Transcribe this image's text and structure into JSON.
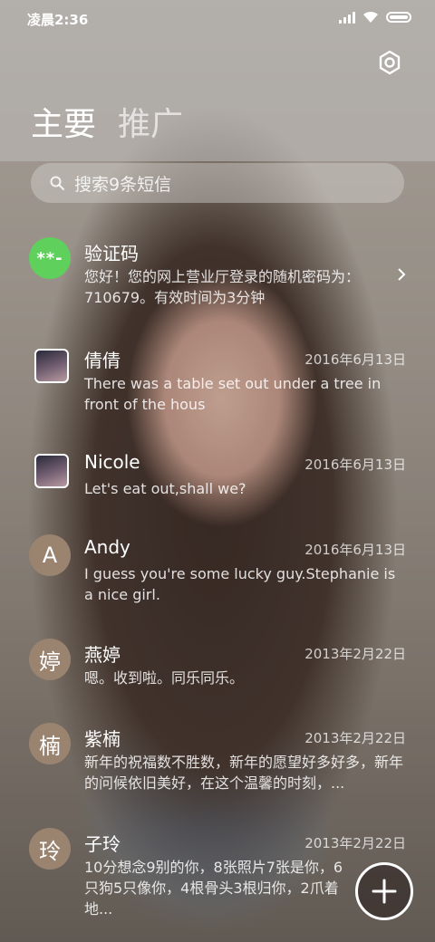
{
  "status_bar": {
    "time": "凌晨2:36"
  },
  "tabs": [
    {
      "label": "主要"
    },
    {
      "label": "推广"
    }
  ],
  "search": {
    "placeholder": "搜索9条短信"
  },
  "conversations": [
    {
      "avatar": "**-",
      "name": "验证码",
      "date": "",
      "preview": "您好！您的网上营业厅登录的随机密码为：710679。有效时间为3分钟"
    },
    {
      "avatar": "",
      "name": "倩倩",
      "date": "2016年6月13日",
      "preview": "There was a table set out under a tree in front of the hous"
    },
    {
      "avatar": "",
      "name": "Nicole",
      "date": "2016年6月13日",
      "preview": "Let's eat out,shall we?"
    },
    {
      "avatar": "A",
      "name": "Andy",
      "date": "2016年6月13日",
      "preview": "I guess you're some lucky guy.Stephanie is a nice girl."
    },
    {
      "avatar": "婷",
      "name": "燕婷",
      "date": "2013年2月22日",
      "preview": "嗯。收到啦。同乐同乐。"
    },
    {
      "avatar": "楠",
      "name": "紫楠",
      "date": "2013年2月22日",
      "preview": "新年的祝福数不胜数，新年的愿望好多好多，新年的问候依旧美好，在这个温馨的时刻，..."
    },
    {
      "avatar": "玲",
      "name": "子玲",
      "date": "2013年2月22日",
      "preview": "10分想念9别的你，8张照片7张是你，6只狗5只像你，4根骨头3根归你，2爪着地..."
    }
  ],
  "colors": {
    "verify_avatar": "#5ed05b",
    "letter_avatar": "#9a8470"
  },
  "icons": {
    "settings": "gear-icon",
    "search": "search-icon",
    "new_message": "plus-icon",
    "expand": "chevron-right-icon"
  }
}
